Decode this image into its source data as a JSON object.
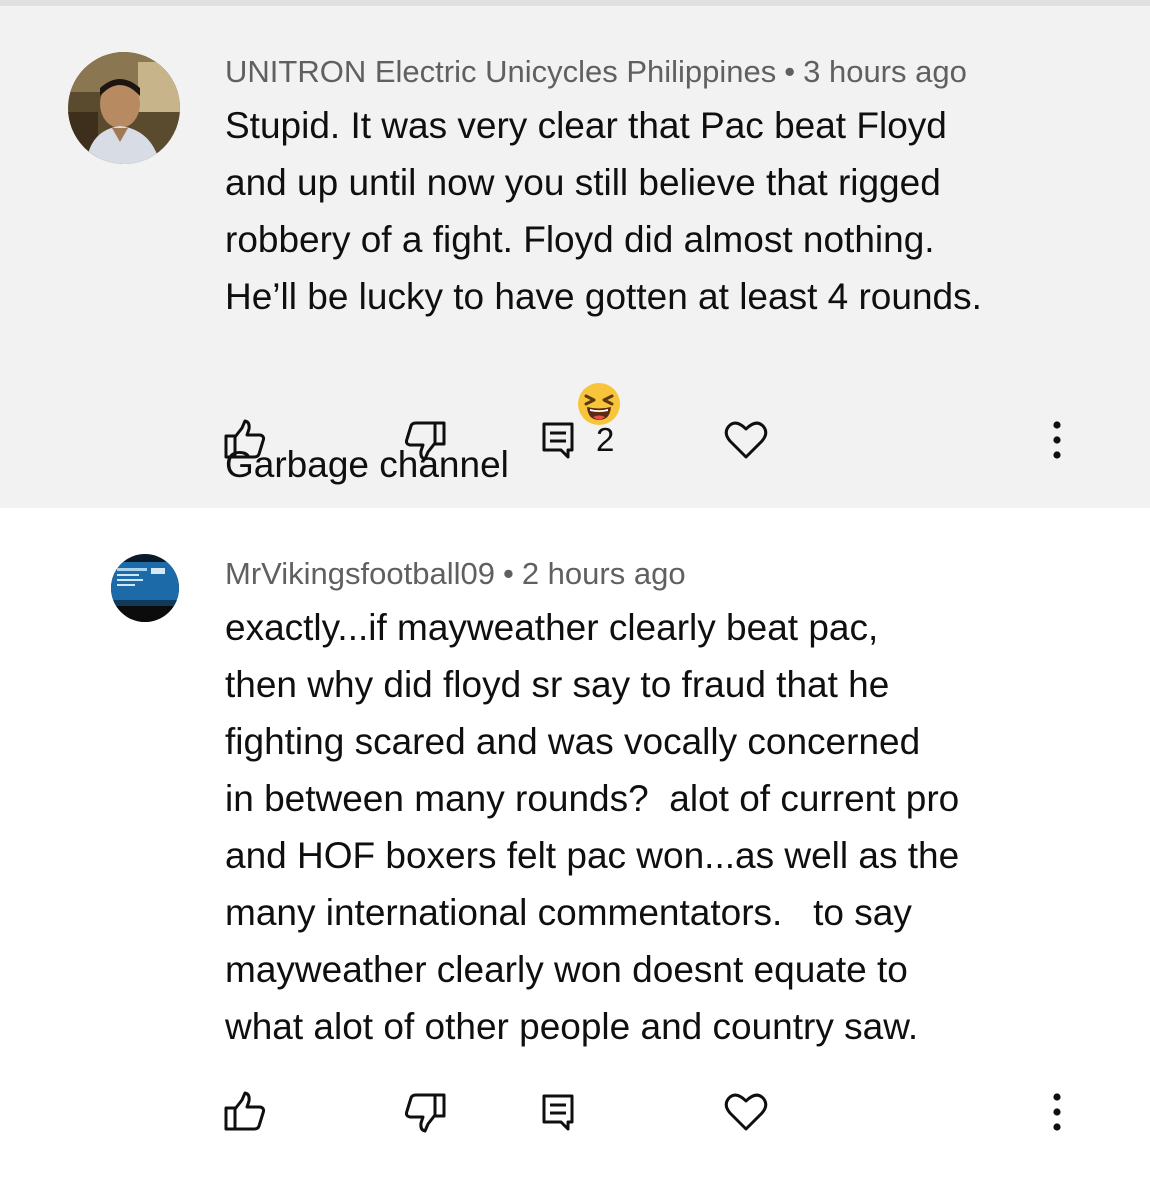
{
  "comments": [
    {
      "author": "UNITRON Electric Unicycles Philippines",
      "separator": "•",
      "time": "3 hours ago",
      "lines": [
        "Stupid. It was very clear that Pac beat Floyd",
        "and up until now you still believe that rigged",
        "robbery of a fight. Floyd did almost nothing.",
        "He’ll be lucky to have gotten at least 4 rounds.",
        "Garbage channel"
      ],
      "emoji": "laughing-squinting-face",
      "reply_count": "2"
    },
    {
      "author": "MrVikingsfootball09",
      "separator": "•",
      "time": "2 hours ago",
      "lines": [
        "exactly...if mayweather clearly beat pac,",
        "then why did floyd sr say to fraud that he",
        "fighting scared and was vocally concerned",
        "in between many rounds?  alot of current pro",
        "and HOF boxers felt pac won...as well as the",
        "many international commentators.   to say",
        "mayweather clearly won doesnt equate to",
        "what alot of other people and country saw."
      ]
    }
  ],
  "icons": {
    "like": "thumbs-up-icon",
    "dislike": "thumbs-down-icon",
    "reply": "reply-comment-icon",
    "heart": "heart-icon",
    "more": "more-vertical-icon"
  },
  "colors": {
    "highlight_bg": "#f2f2f2",
    "meta_text": "#606060",
    "body_text": "#0f0f0f",
    "emoji": "#f7c43b"
  }
}
